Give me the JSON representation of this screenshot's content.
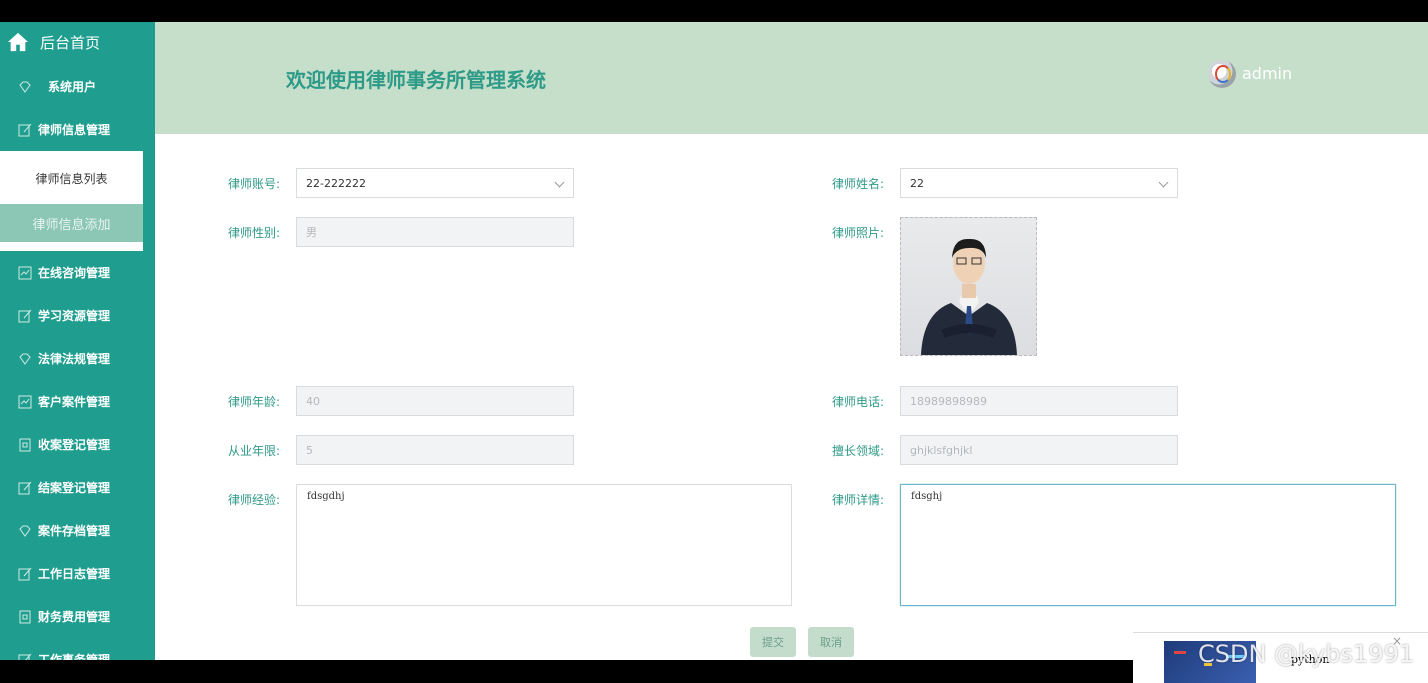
{
  "sidebar": {
    "home": "后台首页",
    "items": [
      {
        "label": "系统用户",
        "icon": "diamond-icon"
      },
      {
        "label": "律师信息管理",
        "icon": "edit-icon"
      },
      {
        "label": "在线咨询管理",
        "icon": "chart-icon"
      },
      {
        "label": "学习资源管理",
        "icon": "edit-icon"
      },
      {
        "label": "法律法规管理",
        "icon": "diamond-icon"
      },
      {
        "label": "客户案件管理",
        "icon": "chart-icon"
      },
      {
        "label": "收案登记管理",
        "icon": "doc-icon"
      },
      {
        "label": "结案登记管理",
        "icon": "edit-icon"
      },
      {
        "label": "案件存档管理",
        "icon": "diamond-icon"
      },
      {
        "label": "工作日志管理",
        "icon": "edit-icon"
      },
      {
        "label": "财务费用管理",
        "icon": "doc-icon"
      },
      {
        "label": "工作事务管理",
        "icon": "edit-icon"
      }
    ],
    "sub_items": [
      "律师信息列表",
      "律师信息添加"
    ]
  },
  "header": {
    "title": "欢迎使用律师事务所管理系统",
    "user": "admin"
  },
  "form": {
    "account": {
      "label": "律师账号:",
      "value": "22-222222"
    },
    "name": {
      "label": "律师姓名:",
      "value": "22"
    },
    "gender": {
      "label": "律师性别:",
      "value": "男"
    },
    "photo": {
      "label": "律师照片:"
    },
    "age": {
      "label": "律师年龄:",
      "value": "40"
    },
    "phone": {
      "label": "律师电话:",
      "value": "18989898989"
    },
    "years": {
      "label": "从业年限:",
      "value": "5"
    },
    "field": {
      "label": "擅长领域:",
      "value": "ghjklsfghjkl"
    },
    "experience": {
      "label": "律师经验:",
      "value": "fdsgdhj"
    },
    "details": {
      "label": "律师详情:",
      "value": "fdsghj"
    }
  },
  "buttons": {
    "submit": "提交",
    "cancel": "取消"
  },
  "overlay": {
    "watermark": "CSDN @kybs1991",
    "popup_text": "python",
    "close": "×"
  }
}
